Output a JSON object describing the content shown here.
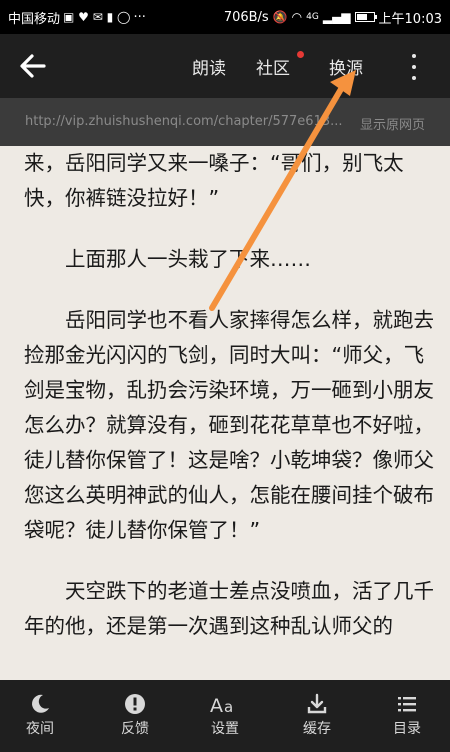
{
  "status_bar": {
    "carrier": "中国移动",
    "more": "···",
    "speed": "706B/s",
    "network": "4G",
    "time": "上午10:03"
  },
  "toolbar": {
    "read_aloud": "朗读",
    "community": "社区",
    "change_source": "换源"
  },
  "url_bar": {
    "url": "http://vip.zhuishushenqi.com/chapter/577e613...",
    "show_original": "显示原网页"
  },
  "content": {
    "paragraphs": [
      "来，岳阳同学又来一嗓子：“哥们，别飞太快，你裤链没拉好！”",
      "上面那人一头栽了下来……",
      "岳阳同学也不看人家摔得怎么样，就跑去捡那金光闪闪的飞剑，同时大叫：“师父，飞剑是宝物，乱扔会污染环境，万一砸到小朋友怎么办？就算没有，砸到花花草草也不好啦，徒儿替你保管了！这是啥？小乾坤袋？像师父您这么英明神武的仙人，怎能在腰间挂个破布袋呢？徒儿替你保管了！”",
      "天空跌下的老道士差点没喷血，活了几千年的他，还是第一次遇到这种乱认师父的"
    ]
  },
  "bottom_bar": {
    "night": "夜间",
    "feedback": "反馈",
    "settings": "设置",
    "cache": "缓存",
    "catalog": "目录"
  },
  "colors": {
    "arrow": "#f5923e",
    "toolbar_bg": "#1f1f1f",
    "page_bg": "#eeeae4"
  }
}
